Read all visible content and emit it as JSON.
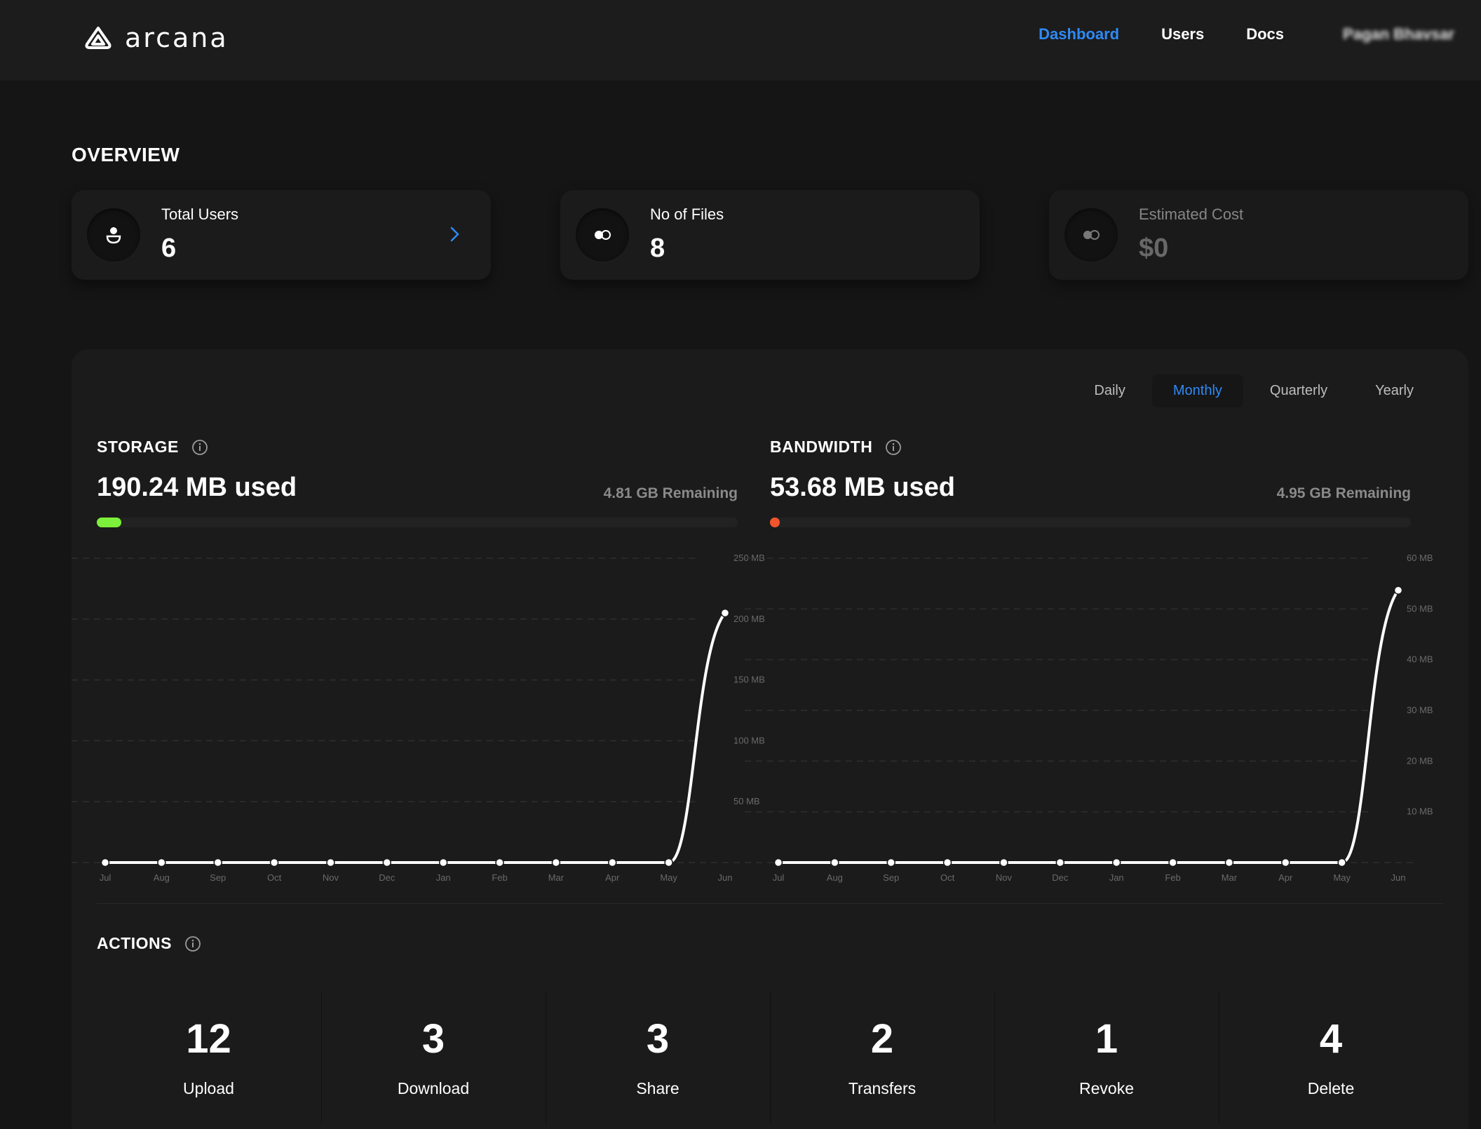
{
  "header": {
    "brand": "arcana",
    "nav": [
      {
        "label": "Dashboard",
        "active": true
      },
      {
        "label": "Users",
        "active": false
      },
      {
        "label": "Docs",
        "active": false
      }
    ],
    "user_name": "Pagan Bhavsar"
  },
  "overview": {
    "title": "OVERVIEW",
    "cards": [
      {
        "label": "Total Users",
        "value": "6",
        "icon": "user-icon"
      },
      {
        "label": "No of Files",
        "value": "8",
        "icon": "files-toggle-icon"
      },
      {
        "label": "Estimated Cost",
        "value": "$0",
        "icon": "cost-toggle-icon"
      }
    ]
  },
  "period_tabs": [
    {
      "label": "Daily",
      "active": false
    },
    {
      "label": "Monthly",
      "active": true
    },
    {
      "label": "Quarterly",
      "active": false
    },
    {
      "label": "Yearly",
      "active": false
    }
  ],
  "storage": {
    "title": "STORAGE",
    "used": "190.24 MB used",
    "remaining": "4.81 GB Remaining",
    "fraction_used": 0.038,
    "bar_color": "#7cf03a"
  },
  "bandwidth": {
    "title": "BANDWIDTH",
    "used": "53.68 MB used",
    "remaining": "4.95 GB Remaining",
    "fraction_used": 0.011,
    "bar_color": "#f5552d"
  },
  "chart_data": [
    {
      "type": "line",
      "categories": [
        "Jul",
        "Aug",
        "Sep",
        "Oct",
        "Nov",
        "Dec",
        "Jan",
        "Feb",
        "Mar",
        "Apr",
        "May",
        "Jun"
      ],
      "values": [
        0,
        0,
        0,
        0,
        0,
        0,
        0,
        0,
        0,
        0,
        0,
        205
      ],
      "y_ticks": [
        "250 MB",
        "200 MB",
        "150 MB",
        "100 MB",
        "50 MB"
      ],
      "y_tick_values": [
        250,
        200,
        150,
        100,
        50
      ],
      "ylim": [
        0,
        250
      ],
      "grid": true,
      "line_color": "#ffffff"
    },
    {
      "type": "line",
      "categories": [
        "Jul",
        "Aug",
        "Sep",
        "Oct",
        "Nov",
        "Dec",
        "Jan",
        "Feb",
        "Mar",
        "Apr",
        "May",
        "Jun"
      ],
      "values": [
        0,
        0,
        0,
        0,
        0,
        0,
        0,
        0,
        0,
        0,
        0,
        53.68
      ],
      "y_ticks": [
        "60 MB",
        "50 MB",
        "40 MB",
        "30 MB",
        "20 MB",
        "10 MB"
      ],
      "y_tick_values": [
        60,
        50,
        40,
        30,
        20,
        10
      ],
      "ylim": [
        0,
        60
      ],
      "grid": true,
      "line_color": "#ffffff"
    }
  ],
  "actions": {
    "title": "ACTIONS",
    "items": [
      {
        "value": "12",
        "label": "Upload"
      },
      {
        "value": "3",
        "label": "Download"
      },
      {
        "value": "3",
        "label": "Share"
      },
      {
        "value": "2",
        "label": "Transfers"
      },
      {
        "value": "1",
        "label": "Revoke"
      },
      {
        "value": "4",
        "label": "Delete"
      }
    ]
  }
}
